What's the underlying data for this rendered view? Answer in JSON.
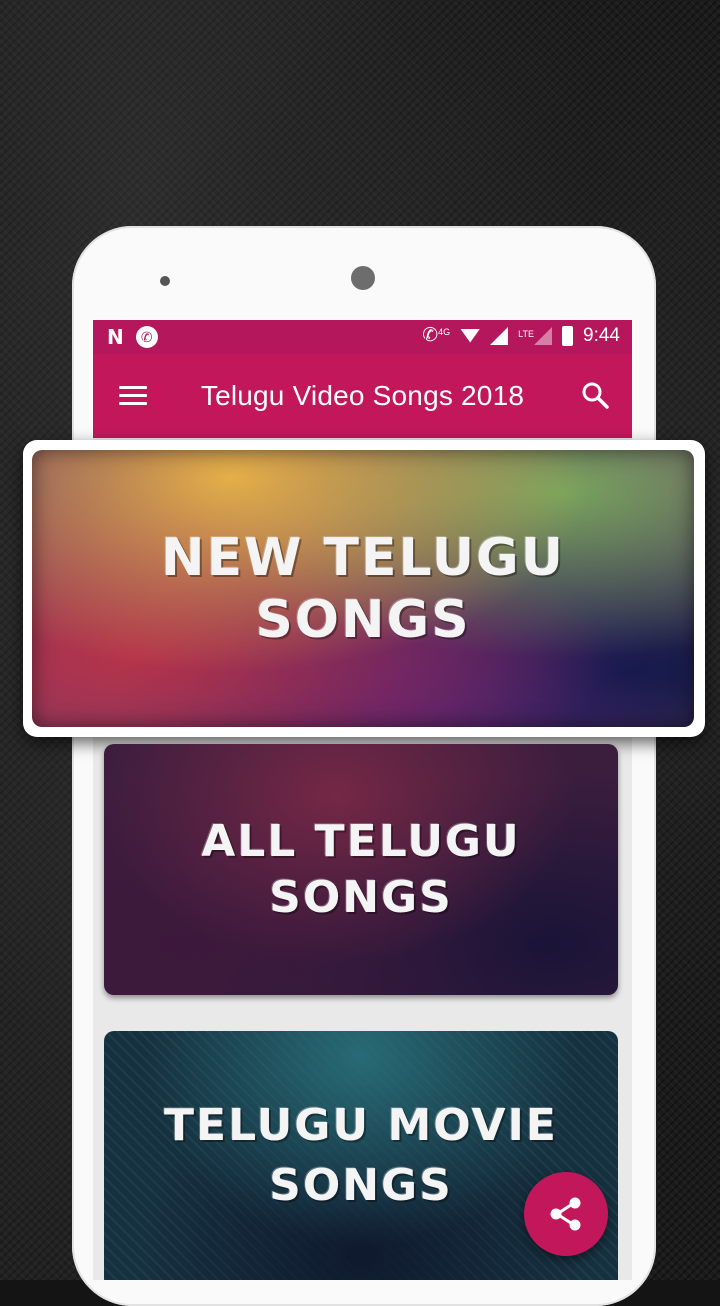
{
  "status_bar": {
    "time": "9:44",
    "network_tag": "LTE",
    "call_tag": "4G",
    "icons": [
      "n-icon",
      "phone-icon",
      "call-4g-icon",
      "wifi-icon",
      "signal-icon",
      "lte-signal-icon",
      "battery-icon"
    ]
  },
  "toolbar": {
    "title": "Telugu Video Songs 2018",
    "menu_icon": "menu-icon",
    "search_icon": "search-icon"
  },
  "cards": [
    {
      "line1": "NEW TELUGU",
      "line2": "SONGS"
    },
    {
      "line1": "ALL TELUGU",
      "line2": "SONGS"
    },
    {
      "line1": "TELUGU MOVIE",
      "line2": "SONGS"
    }
  ],
  "fab": {
    "icon": "share-icon"
  },
  "colors": {
    "primary": "#c2185b",
    "status": "#b5175c"
  }
}
